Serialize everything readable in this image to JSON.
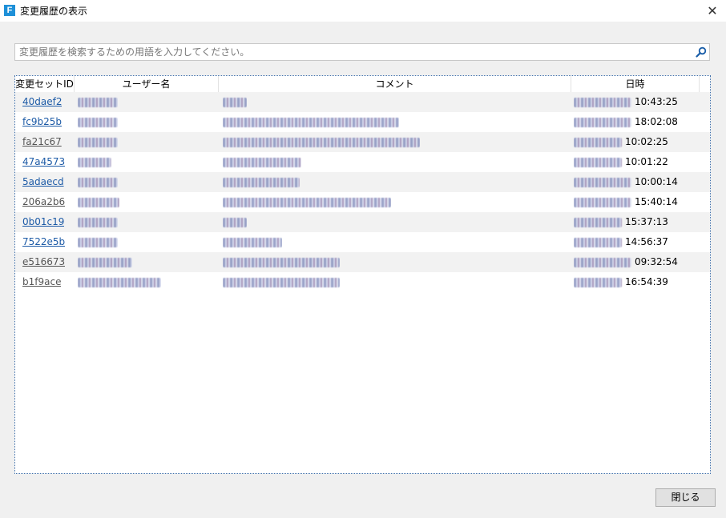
{
  "window": {
    "title": "変更履歴の表示",
    "app_icon_letter": "F",
    "close_glyph": "✕"
  },
  "search": {
    "placeholder": "変更履歴を検索するための用語を入力してください。",
    "value": ""
  },
  "table": {
    "columns": [
      "変更セットID",
      "ユーザー名",
      "コメント",
      "日時"
    ],
    "rows": [
      {
        "id": "40daef2",
        "time": "10:43:25",
        "visited": false
      },
      {
        "id": "fc9b25b",
        "time": "18:02:08",
        "visited": false
      },
      {
        "id": "fa21c67",
        "time": "10:02:25",
        "visited": true
      },
      {
        "id": "47a4573",
        "time": "10:01:22",
        "visited": false
      },
      {
        "id": "5adaecd",
        "time": "10:00:14",
        "visited": false
      },
      {
        "id": "206a2b6",
        "time": "15:40:14",
        "visited": true
      },
      {
        "id": "0b01c19",
        "time": "15:37:13",
        "visited": false
      },
      {
        "id": "7522e5b",
        "time": "14:56:37",
        "visited": false
      },
      {
        "id": "e516673",
        "time": "09:32:54",
        "visited": true
      },
      {
        "id": "b1f9ace",
        "time": "16:54:39",
        "visited": true
      }
    ]
  },
  "footer": {
    "close_label": "閉じる"
  }
}
